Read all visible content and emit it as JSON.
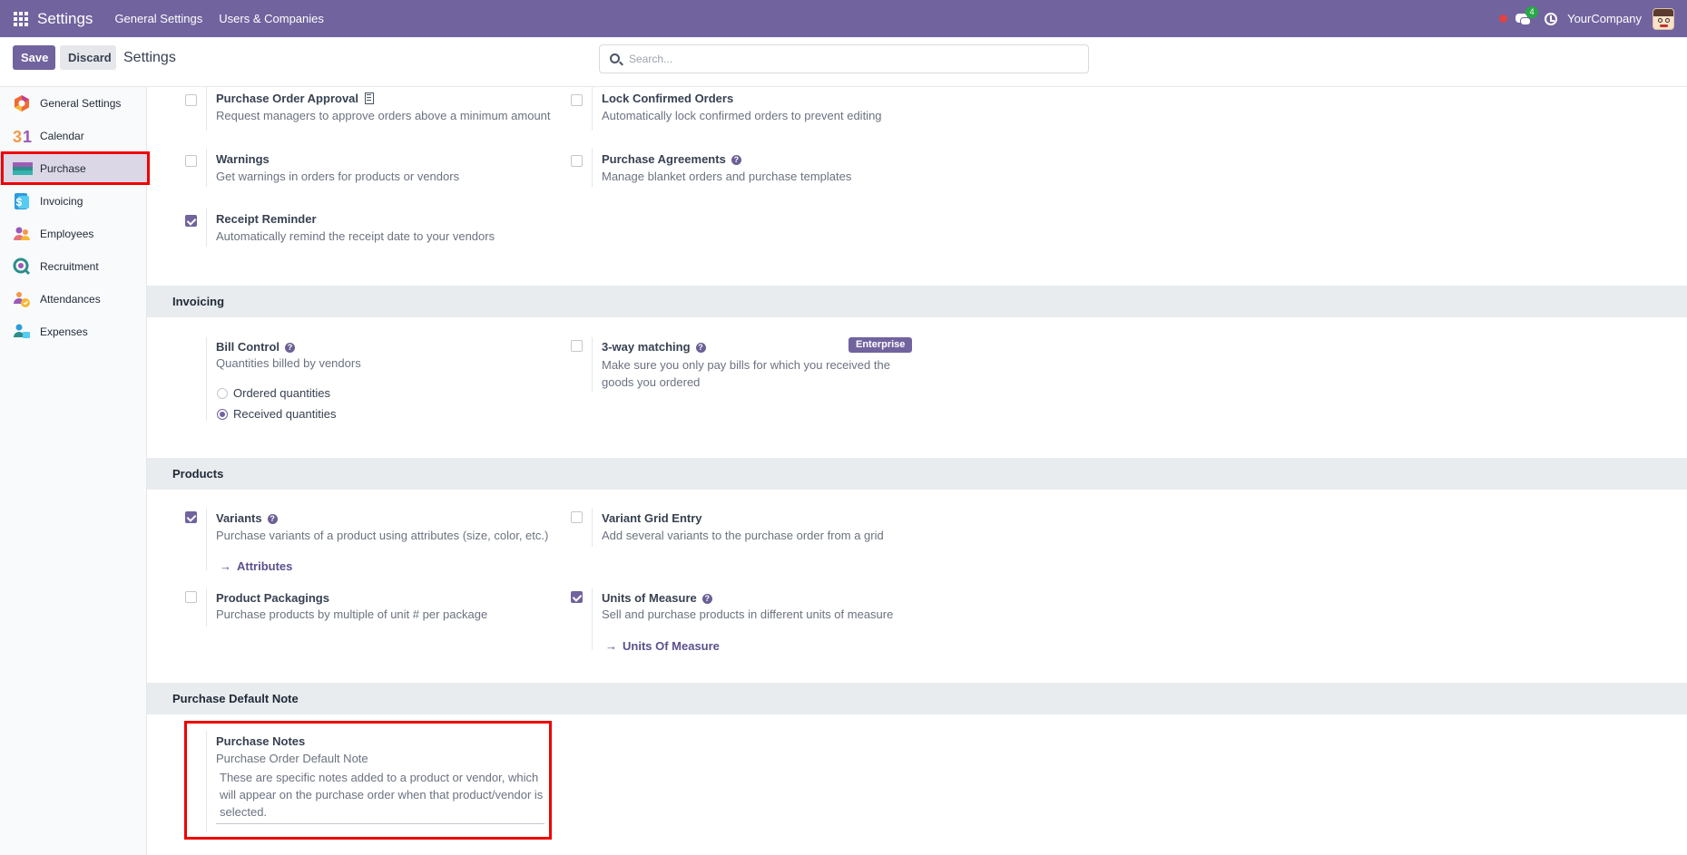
{
  "navbar": {
    "brand": "Settings",
    "menus": [
      "General Settings",
      "Users & Companies"
    ],
    "chat_count": "4",
    "company": "YourCompany"
  },
  "control": {
    "save_label": "Save",
    "discard_label": "Discard",
    "breadcrumb": "Settings",
    "search_placeholder": "Search..."
  },
  "sidebar": {
    "items": [
      {
        "label": "General Settings",
        "icon": "general-settings-icon"
      },
      {
        "label": "Calendar",
        "icon": "calendar-icon"
      },
      {
        "label": "Purchase",
        "icon": "purchase-icon",
        "active": true
      },
      {
        "label": "Invoicing",
        "icon": "invoicing-icon"
      },
      {
        "label": "Employees",
        "icon": "employees-icon"
      },
      {
        "label": "Recruitment",
        "icon": "recruitment-icon"
      },
      {
        "label": "Attendances",
        "icon": "attendances-icon"
      },
      {
        "label": "Expenses",
        "icon": "expenses-icon"
      }
    ]
  },
  "orders": {
    "approval": {
      "title": "Purchase Order Approval",
      "desc": "Request managers to approve orders above a minimum amount",
      "checked": false
    },
    "lock": {
      "title": "Lock Confirmed Orders",
      "desc": "Automatically lock confirmed orders to prevent editing",
      "checked": false
    },
    "warnings": {
      "title": "Warnings",
      "desc": "Get warnings in orders for products or vendors",
      "checked": false
    },
    "agreements": {
      "title": "Purchase Agreements",
      "desc": "Manage blanket orders and purchase templates",
      "checked": false
    },
    "receipt": {
      "title": "Receipt Reminder",
      "desc": "Automatically remind the receipt date to your vendors",
      "checked": true
    }
  },
  "invoicing": {
    "title": "Invoicing",
    "bill_control": {
      "title": "Bill Control",
      "desc": "Quantities billed by vendors",
      "options": [
        "Ordered quantities",
        "Received quantities"
      ],
      "selected": "Received quantities"
    },
    "three_way": {
      "title": "3-way matching",
      "badge": "Enterprise",
      "desc": "Make sure you only pay bills for which you received the goods you ordered",
      "checked": false
    }
  },
  "products": {
    "title": "Products",
    "variants": {
      "title": "Variants",
      "desc": "Purchase variants of a product using attributes (size, color, etc.)",
      "link": "Attributes",
      "checked": true
    },
    "grid": {
      "title": "Variant Grid Entry",
      "desc": "Add several variants to the purchase order from a grid",
      "checked": false
    },
    "packagings": {
      "title": "Product Packagings",
      "desc": "Purchase products by multiple of unit # per package",
      "checked": false
    },
    "uom": {
      "title": "Units of Measure",
      "desc": "Sell and purchase products in different units of measure",
      "link": "Units Of Measure",
      "checked": true
    }
  },
  "default_note": {
    "title": "Purchase Default Note",
    "notes_title": "Purchase Notes",
    "notes_desc": "Purchase Order Default Note",
    "notes_value": "These are specific notes added to a product or vendor, which will appear on the purchase order when that product/vendor is selected."
  },
  "colors": {
    "brand": "#71639e",
    "highlight": "#ee0000",
    "section_bg": "#e9ecef"
  }
}
